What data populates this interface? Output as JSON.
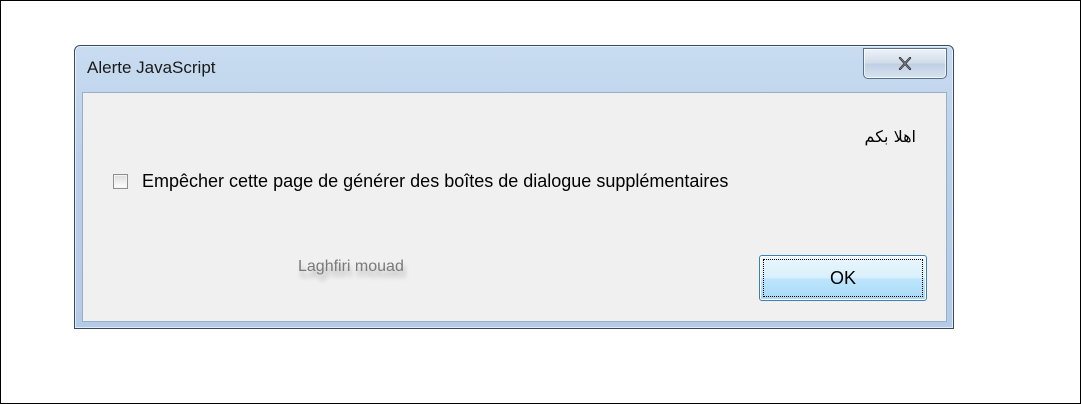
{
  "dialog": {
    "title": "Alerte JavaScript",
    "close_icon": "close-x-icon",
    "message": "اهلا بكم",
    "checkbox": {
      "label": "Empêcher cette page de générer des boîtes de dialogue supplémentaires",
      "checked": false
    },
    "watermark": "Laghfiri mouad",
    "ok_label": "OK"
  }
}
